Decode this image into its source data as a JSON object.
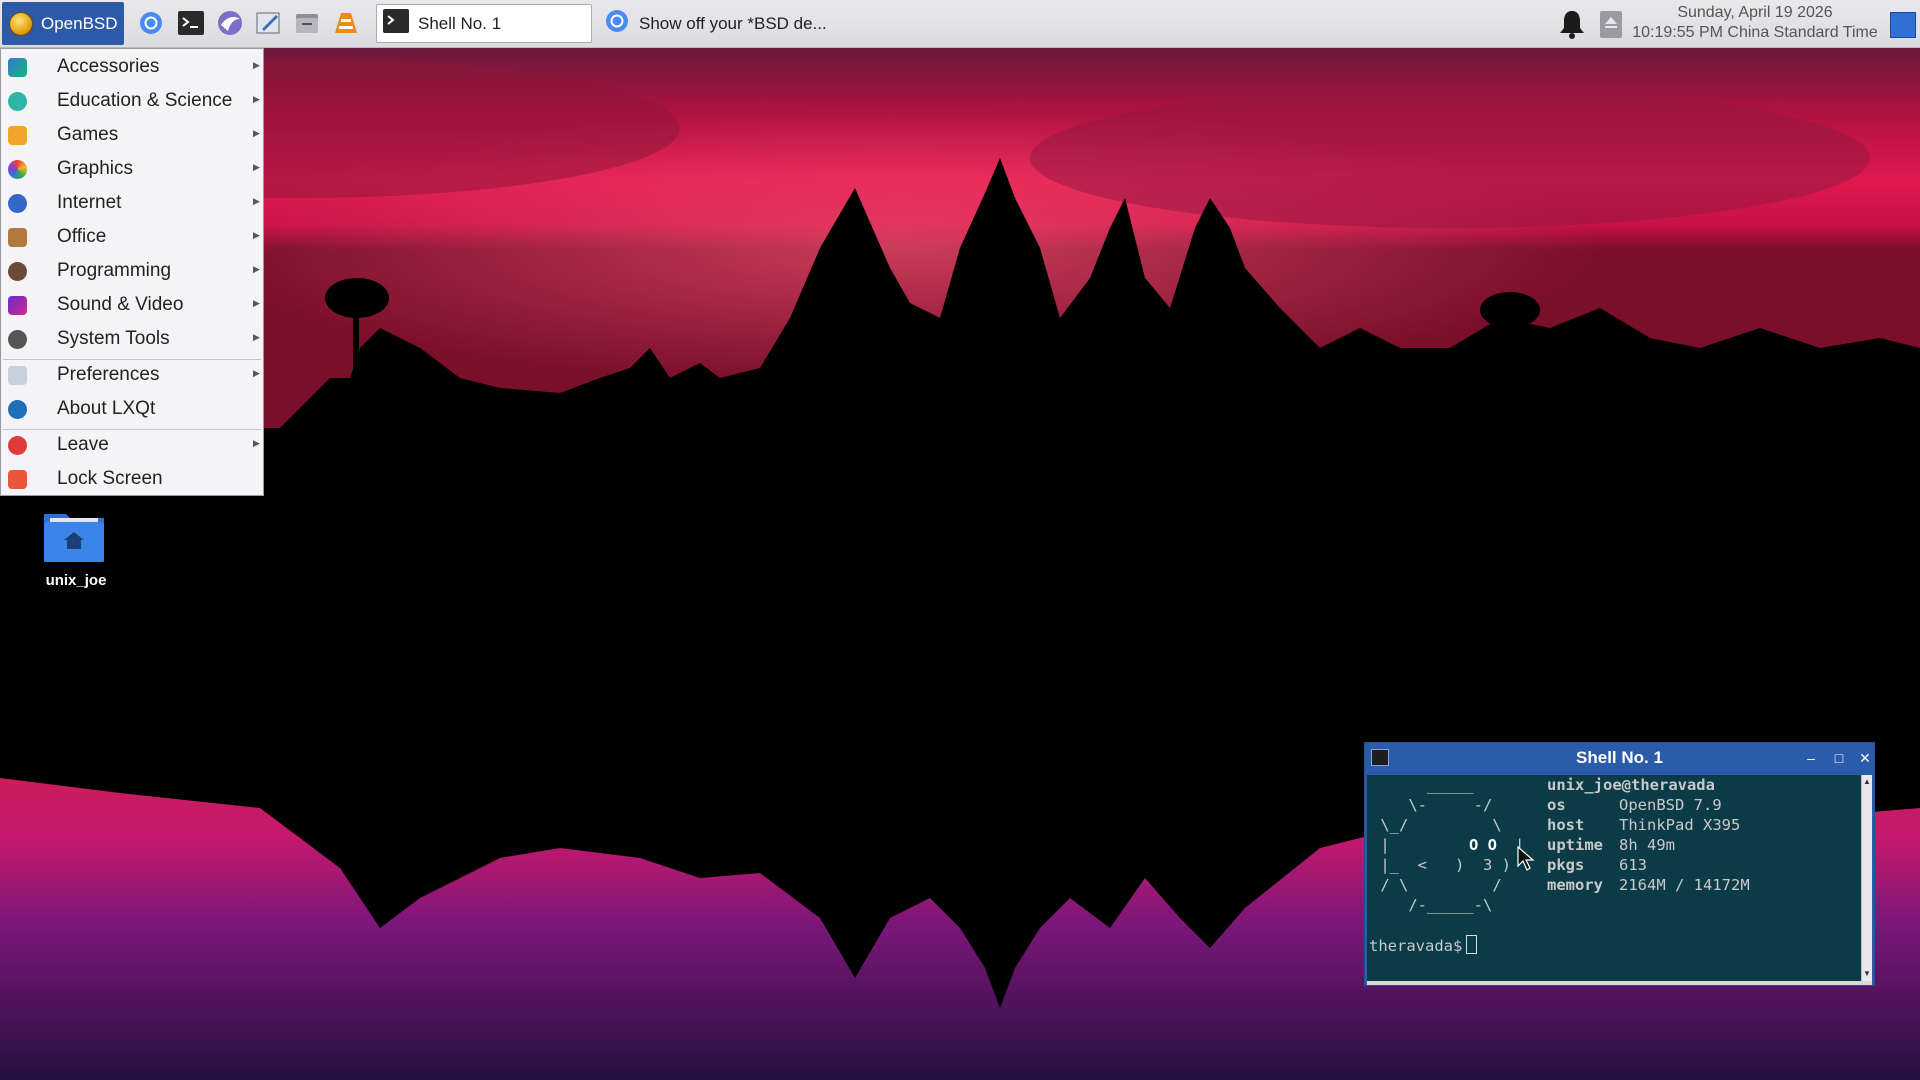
{
  "taskbar": {
    "start_label": "OpenBSD",
    "quicklaunch": [
      "chromium-icon",
      "terminal-icon",
      "falkon-browser-icon",
      "text-editor-icon",
      "file-manager-icon",
      "vlc-icon"
    ],
    "tasks": [
      {
        "label": "Shell No. 1",
        "icon": "terminal-icon",
        "active": true
      },
      {
        "label": "Show off your *BSD de...",
        "icon": "chromium-icon",
        "active": false
      }
    ],
    "clock": {
      "date": "Sunday, April 19 2026",
      "time": "10:19:55 PM China Standard Time"
    }
  },
  "menu": {
    "items": [
      {
        "label": "Accessories",
        "icon": "accessories-icon",
        "submenu": true
      },
      {
        "label": "Education & Science",
        "icon": "education-icon",
        "submenu": true
      },
      {
        "label": "Games",
        "icon": "games-icon",
        "submenu": true
      },
      {
        "label": "Graphics",
        "icon": "graphics-icon",
        "submenu": true
      },
      {
        "label": "Internet",
        "icon": "internet-icon",
        "submenu": true
      },
      {
        "label": "Office",
        "icon": "office-icon",
        "submenu": true
      },
      {
        "label": "Programming",
        "icon": "programming-icon",
        "submenu": true
      },
      {
        "label": "Sound & Video",
        "icon": "sound-video-icon",
        "submenu": true
      },
      {
        "label": "System Tools",
        "icon": "system-tools-icon",
        "submenu": true
      },
      {
        "label": "Preferences",
        "icon": "preferences-icon",
        "submenu": true
      },
      {
        "label": "About LXQt",
        "icon": "lxqt-icon",
        "submenu": false
      },
      {
        "label": "Leave",
        "icon": "power-icon",
        "submenu": true
      },
      {
        "label": "Lock Screen",
        "icon": "lock-icon",
        "submenu": false
      }
    ]
  },
  "desktop": {
    "home_folder": "unix_joe"
  },
  "terminal": {
    "title": "Shell No. 1",
    "ascii_art": [
      "      _____",
      "    \\-     -/",
      " \\_/         \\",
      " |        ",
      " |_  <   )  3 )",
      " / \\         /",
      "    /-_____-\\"
    ],
    "eyes": "O O",
    "eye_bar": "|",
    "user_host": "unix_joe@theravada",
    "info": [
      {
        "key": "os",
        "value": "OpenBSD 7.9"
      },
      {
        "key": "host",
        "value": "ThinkPad X395"
      },
      {
        "key": "uptime",
        "value": "8h 49m"
      },
      {
        "key": "pkgs",
        "value": "613"
      },
      {
        "key": "memory",
        "value": "2164M / 14172M"
      }
    ],
    "prompt": "theravada$"
  },
  "colors": {
    "taskbar_start": "#2c5aa8",
    "window_title": "#2b5caa",
    "terminal_bg": "#0c3b48"
  }
}
